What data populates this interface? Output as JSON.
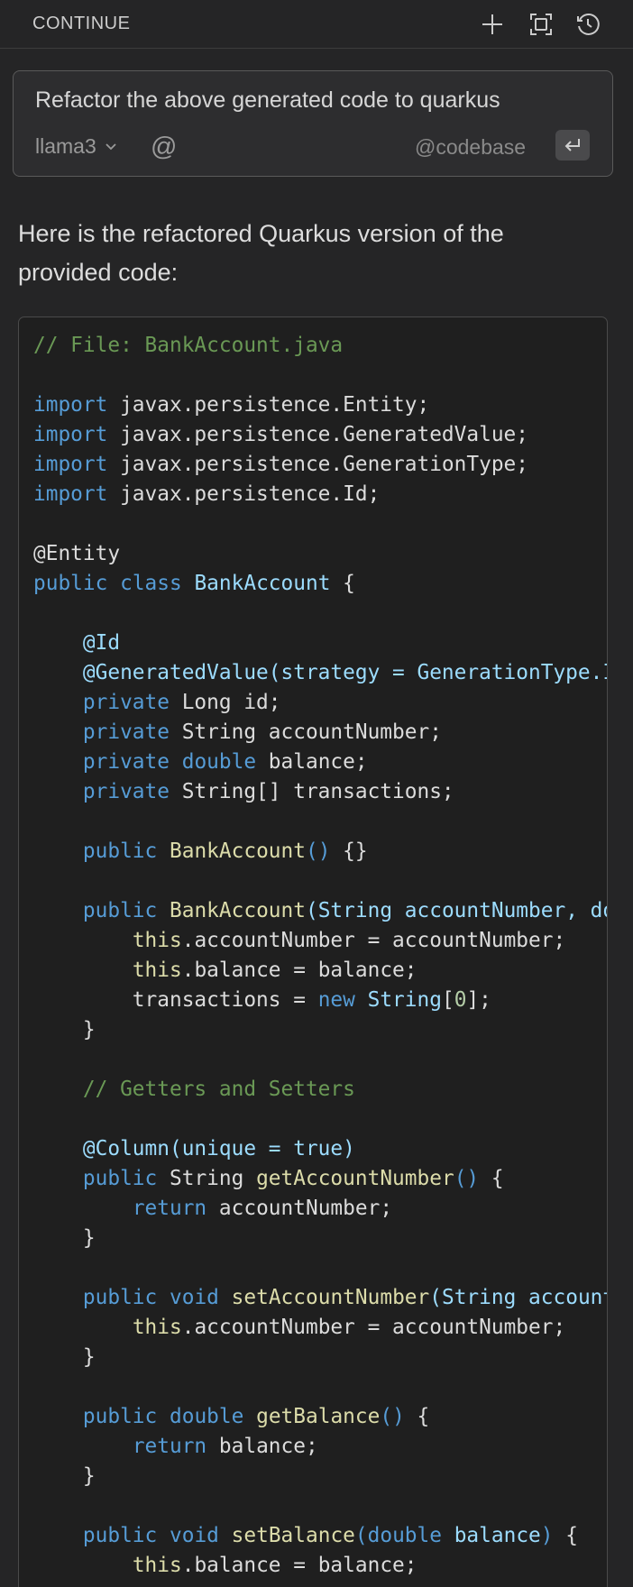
{
  "header": {
    "title": "CONTINUE",
    "icons": [
      "plus-icon",
      "fullscreen-icon",
      "history-icon"
    ]
  },
  "input": {
    "text": "Refactor the above generated code to quarkus",
    "model": "llama3",
    "mention_symbol": "@",
    "context_label": "@codebase"
  },
  "response": {
    "text": "Here is the refactored Quarkus version of the provided code:"
  },
  "colors": {
    "background": "#252526",
    "code_background": "#1f1f1f",
    "comment": "#6a9955",
    "keyword": "#569cd6",
    "function": "#dcdcaa",
    "variable": "#9cdcfe",
    "number": "#b5cea8"
  },
  "code": {
    "language": "java",
    "lines": [
      [
        [
          "comment",
          "// File: BankAccount.java"
        ]
      ],
      [],
      [
        [
          "keyword",
          "import"
        ],
        [
          "plain",
          " javax.persistence.Entity;"
        ]
      ],
      [
        [
          "keyword",
          "import"
        ],
        [
          "plain",
          " javax.persistence.GeneratedValue;"
        ]
      ],
      [
        [
          "keyword",
          "import"
        ],
        [
          "plain",
          " javax.persistence.GenerationType;"
        ]
      ],
      [
        [
          "keyword",
          "import"
        ],
        [
          "plain",
          " javax.persistence.Id;"
        ]
      ],
      [],
      [
        [
          "annot",
          "@Entity"
        ]
      ],
      [
        [
          "keyword",
          "public"
        ],
        [
          "plain",
          " "
        ],
        [
          "keyword",
          "class"
        ],
        [
          "plain",
          " "
        ],
        [
          "class",
          "BankAccount"
        ],
        [
          "plain",
          " {"
        ]
      ],
      [],
      [
        [
          "plain",
          "    "
        ],
        [
          "class",
          "@Id"
        ]
      ],
      [
        [
          "plain",
          "    "
        ],
        [
          "class",
          "@GeneratedValue(strategy = GenerationType.IDENTITY)"
        ]
      ],
      [
        [
          "plain",
          "    "
        ],
        [
          "keyword",
          "private"
        ],
        [
          "plain",
          " Long id;"
        ]
      ],
      [
        [
          "plain",
          "    "
        ],
        [
          "keyword",
          "private"
        ],
        [
          "plain",
          " String accountNumber;"
        ]
      ],
      [
        [
          "plain",
          "    "
        ],
        [
          "keyword",
          "private"
        ],
        [
          "plain",
          " "
        ],
        [
          "keyword",
          "double"
        ],
        [
          "plain",
          " balance;"
        ]
      ],
      [
        [
          "plain",
          "    "
        ],
        [
          "keyword",
          "private"
        ],
        [
          "plain",
          " String[] transactions;"
        ]
      ],
      [],
      [
        [
          "plain",
          "    "
        ],
        [
          "keyword",
          "public"
        ],
        [
          "plain",
          " "
        ],
        [
          "func",
          "BankAccount"
        ],
        [
          "keyword",
          "()"
        ],
        [
          "plain",
          " {}"
        ]
      ],
      [],
      [
        [
          "plain",
          "    "
        ],
        [
          "keyword",
          "public"
        ],
        [
          "plain",
          " "
        ],
        [
          "func",
          "BankAccount"
        ],
        [
          "class",
          "(String accountNumber, double balance) {"
        ]
      ],
      [
        [
          "plain",
          "        "
        ],
        [
          "this",
          "this"
        ],
        [
          "plain",
          ".accountNumber = accountNumber;"
        ]
      ],
      [
        [
          "plain",
          "        "
        ],
        [
          "this",
          "this"
        ],
        [
          "plain",
          ".balance = balance;"
        ]
      ],
      [
        [
          "plain",
          "        transactions = "
        ],
        [
          "keyword",
          "new"
        ],
        [
          "plain",
          " "
        ],
        [
          "class",
          "String"
        ],
        [
          "plain",
          "["
        ],
        [
          "number",
          "0"
        ],
        [
          "plain",
          "];"
        ]
      ],
      [
        [
          "plain",
          "    }"
        ]
      ],
      [],
      [
        [
          "plain",
          "    "
        ],
        [
          "comment",
          "// Getters and Setters"
        ]
      ],
      [],
      [
        [
          "plain",
          "    "
        ],
        [
          "class",
          "@Column(unique = true)"
        ]
      ],
      [
        [
          "plain",
          "    "
        ],
        [
          "keyword",
          "public"
        ],
        [
          "plain",
          " String "
        ],
        [
          "func",
          "getAccountNumber"
        ],
        [
          "keyword",
          "()"
        ],
        [
          "plain",
          " {"
        ]
      ],
      [
        [
          "plain",
          "        "
        ],
        [
          "keyword",
          "return"
        ],
        [
          "plain",
          " accountNumber;"
        ]
      ],
      [
        [
          "plain",
          "    }"
        ]
      ],
      [],
      [
        [
          "plain",
          "    "
        ],
        [
          "keyword",
          "public"
        ],
        [
          "plain",
          " "
        ],
        [
          "keyword",
          "void"
        ],
        [
          "plain",
          " "
        ],
        [
          "func",
          "setAccountNumber"
        ],
        [
          "class",
          "(String accountNumber) {"
        ]
      ],
      [
        [
          "plain",
          "        "
        ],
        [
          "this",
          "this"
        ],
        [
          "plain",
          ".accountNumber = accountNumber;"
        ]
      ],
      [
        [
          "plain",
          "    }"
        ]
      ],
      [],
      [
        [
          "plain",
          "    "
        ],
        [
          "keyword",
          "public"
        ],
        [
          "plain",
          " "
        ],
        [
          "keyword",
          "double"
        ],
        [
          "plain",
          " "
        ],
        [
          "func",
          "getBalance"
        ],
        [
          "keyword",
          "()"
        ],
        [
          "plain",
          " {"
        ]
      ],
      [
        [
          "plain",
          "        "
        ],
        [
          "keyword",
          "return"
        ],
        [
          "plain",
          " balance;"
        ]
      ],
      [
        [
          "plain",
          "    }"
        ]
      ],
      [],
      [
        [
          "plain",
          "    "
        ],
        [
          "keyword",
          "public"
        ],
        [
          "plain",
          " "
        ],
        [
          "keyword",
          "void"
        ],
        [
          "plain",
          " "
        ],
        [
          "func",
          "setBalance"
        ],
        [
          "keyword",
          "("
        ],
        [
          "keyword",
          "double"
        ],
        [
          "param",
          " balance"
        ],
        [
          "keyword",
          ")"
        ],
        [
          "plain",
          " {"
        ]
      ],
      [
        [
          "plain",
          "        "
        ],
        [
          "this",
          "this"
        ],
        [
          "plain",
          ".balance = balance;"
        ]
      ]
    ]
  }
}
